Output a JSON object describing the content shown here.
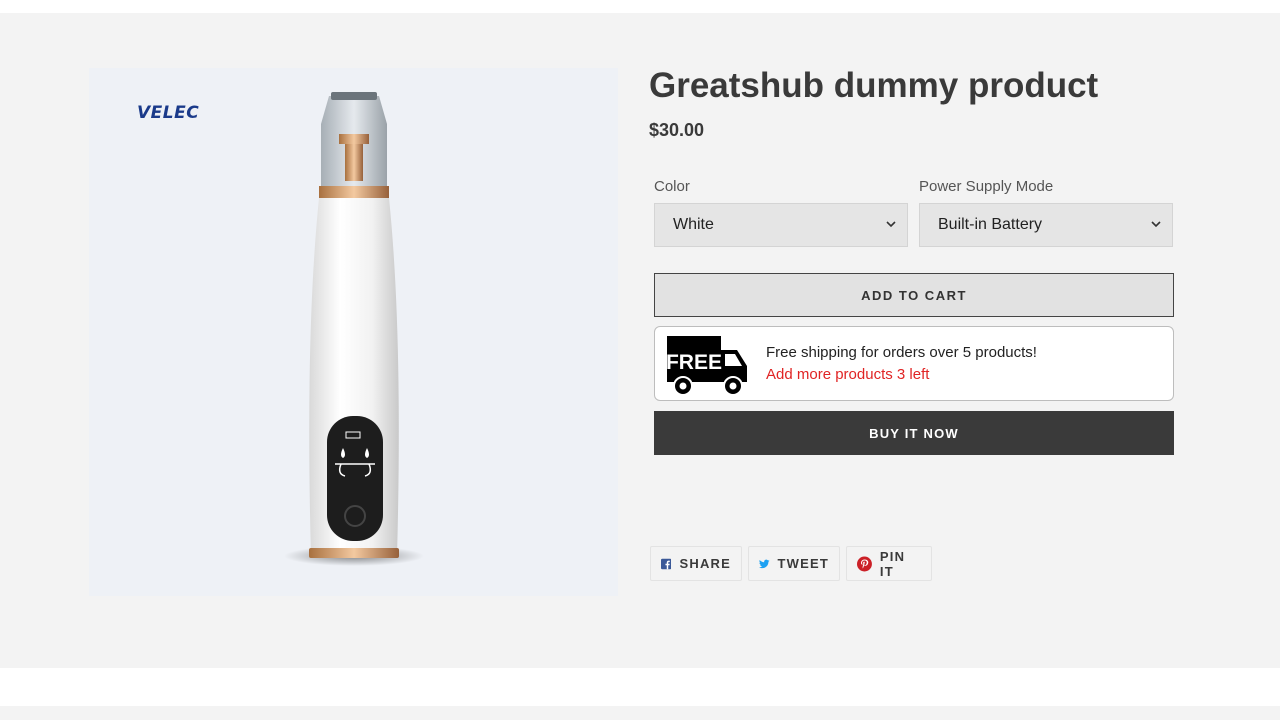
{
  "product": {
    "title": "Greatshub dummy product",
    "price": "$30.00",
    "image_brand": "VELEC"
  },
  "options": [
    {
      "label": "Color",
      "value": "White"
    },
    {
      "label": "Power Supply Mode",
      "value": "Built-in Battery"
    }
  ],
  "buttons": {
    "add_to_cart": "ADD TO CART",
    "buy_now": "BUY IT NOW"
  },
  "shipping": {
    "badge_text": "FREE",
    "line1": "Free shipping for orders over 5 products!",
    "line2": "Add more products 3 left"
  },
  "share": [
    {
      "label": "SHARE",
      "icon": "facebook-icon"
    },
    {
      "label": "TWEET",
      "icon": "twitter-icon"
    },
    {
      "label": "PIN IT",
      "icon": "pinterest-icon"
    }
  ],
  "colors": {
    "background": "#f3f3f3",
    "text": "#3a3a3a",
    "buy_now_bg": "#3a3a3a",
    "alert_red": "#e02424",
    "facebook": "#3b5998",
    "twitter": "#1da1f2",
    "pinterest": "#cb2027"
  }
}
